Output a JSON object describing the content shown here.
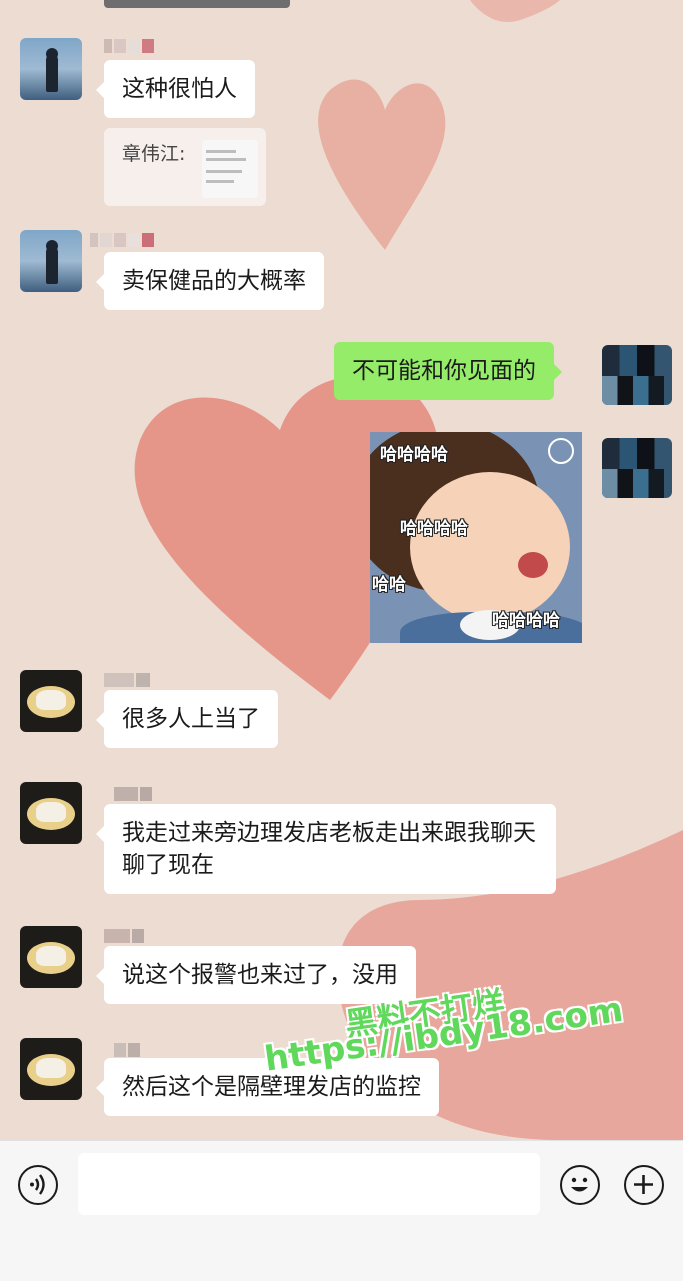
{
  "messages": {
    "m1": {
      "text": "这种很怕人"
    },
    "m1_quote": {
      "text": "章伟江:"
    },
    "m2": {
      "text": "卖保健品的大概率"
    },
    "m3": {
      "text": "不可能和你见面的"
    },
    "sticker": {
      "captions": [
        "哈哈哈哈",
        "哈哈哈哈",
        "哈哈",
        "哈哈哈哈"
      ]
    },
    "m4": {
      "text": "很多人上当了"
    },
    "m5": {
      "text": "我走过来旁边理发店老板走出来跟我聊天聊了现在"
    },
    "m6": {
      "text": "说这个报警也来过了，没用"
    },
    "m7": {
      "text": "然后这个是隔壁理发店的监控"
    }
  },
  "watermark": {
    "line1": "黑料不打烊",
    "line2": "https://ibdy18.com"
  },
  "colors": {
    "background": "#ecdcd2",
    "heart": "#e88a7c",
    "bubble_self": "#95ec69",
    "bubble_other": "#ffffff",
    "watermark": "#5fd85b"
  },
  "icons": {
    "voice": "voice-icon",
    "emoji": "emoji-icon",
    "plus": "plus-icon"
  }
}
